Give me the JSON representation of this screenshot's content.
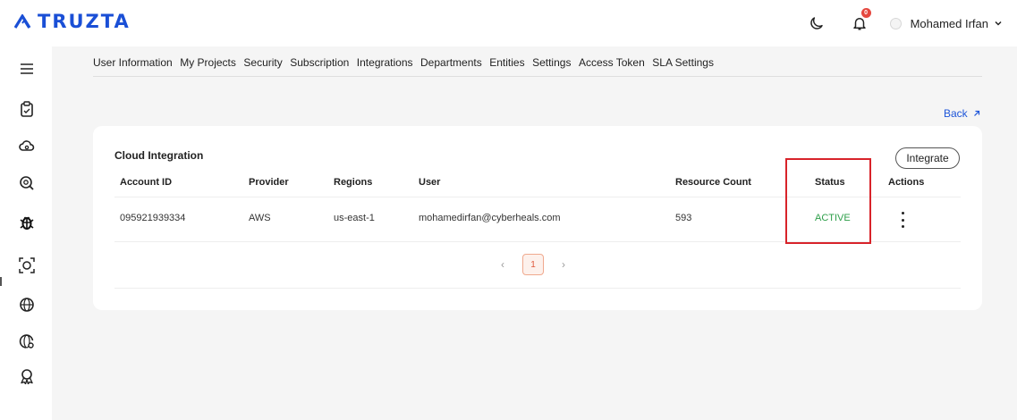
{
  "app": {
    "logo_text": "TRUZTA",
    "brand_color": "#1a4fd6"
  },
  "header": {
    "notification_count": "0",
    "user_name": "Mohamed Irfan"
  },
  "sidebar": {
    "items": [
      {
        "icon": "menu-icon"
      },
      {
        "icon": "clipboard-icon"
      },
      {
        "icon": "cloud-icon"
      },
      {
        "icon": "scan-search-icon"
      },
      {
        "icon": "bug-icon"
      },
      {
        "icon": "focus-scan-icon"
      },
      {
        "icon": "globe-icon"
      },
      {
        "icon": "globe-settings-icon"
      },
      {
        "icon": "award-icon"
      }
    ]
  },
  "tabs": [
    "User Information",
    "My Projects",
    "Security",
    "Subscription",
    "Integrations",
    "Departments",
    "Entities",
    "Settings",
    "Access Token",
    "SLA Settings"
  ],
  "back_label": "Back",
  "card": {
    "title": "Cloud Integration",
    "integrate_label": "Integrate",
    "columns": [
      "Account ID",
      "Provider",
      "Regions",
      "User",
      "Resource Count",
      "Status",
      "Actions"
    ],
    "rows": [
      {
        "account_id": "095921939334",
        "provider": "AWS",
        "region": "us-east-1",
        "user": "mohamedirfan@cyberheals.com",
        "resource_count": "593",
        "status": "ACTIVE"
      }
    ],
    "status_color": "#2e9f4a",
    "pagination": {
      "prev": "‹",
      "current": "1",
      "next": "›"
    }
  },
  "colors": {
    "highlight": "#d8232a",
    "page_accent": "#e0583b"
  }
}
